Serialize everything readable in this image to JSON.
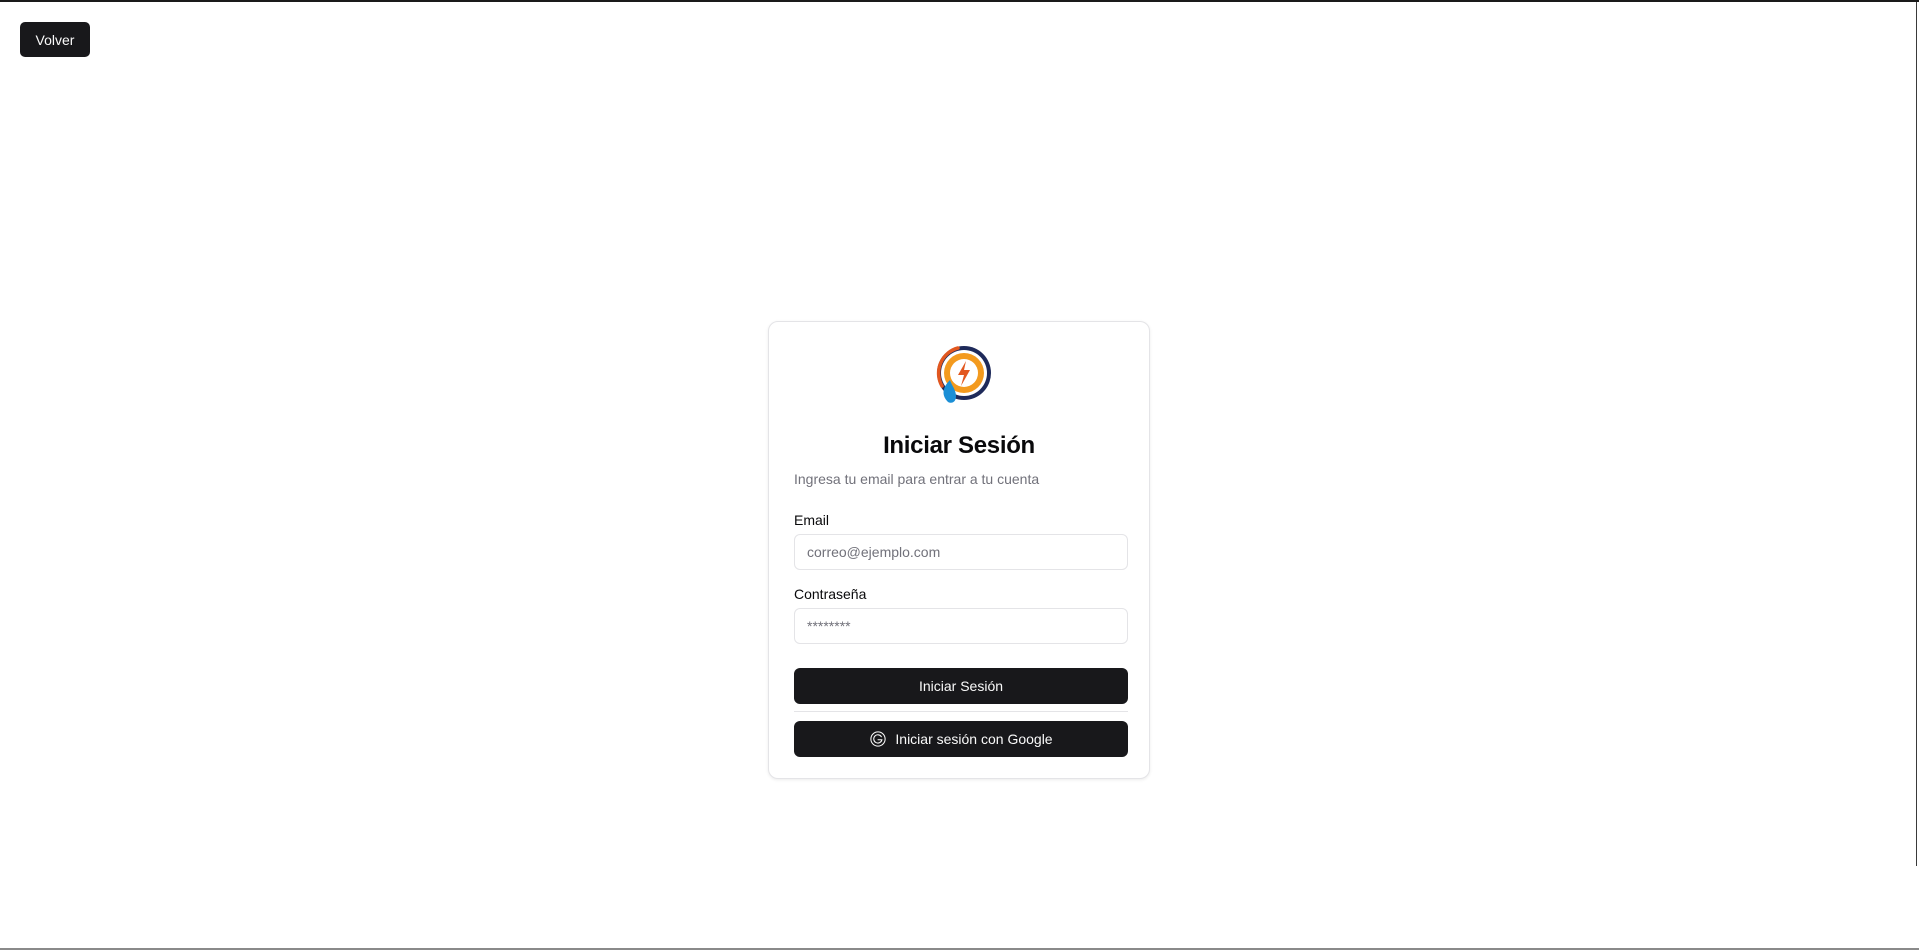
{
  "header": {
    "back_label": "Volver"
  },
  "login": {
    "logo_icon": "brand-logo-icon",
    "title": "Iniciar Sesión",
    "subtitle": "Ingresa tu email para entrar a tu cuenta",
    "email_label": "Email",
    "email_placeholder": "correo@ejemplo.com",
    "password_label": "Contraseña",
    "password_placeholder": "********",
    "submit_label": "Iniciar Sesión",
    "google_label": "Iniciar sesión con Google",
    "google_icon": "google-icon"
  },
  "colors": {
    "primary_button": "#18181b",
    "button_text": "#fafafa",
    "border": "#e4e4e7",
    "muted_text": "#71717a",
    "logo_navy": "#1e2a5a",
    "logo_orange": "#f39a1e",
    "logo_blue": "#1b8fd6"
  }
}
